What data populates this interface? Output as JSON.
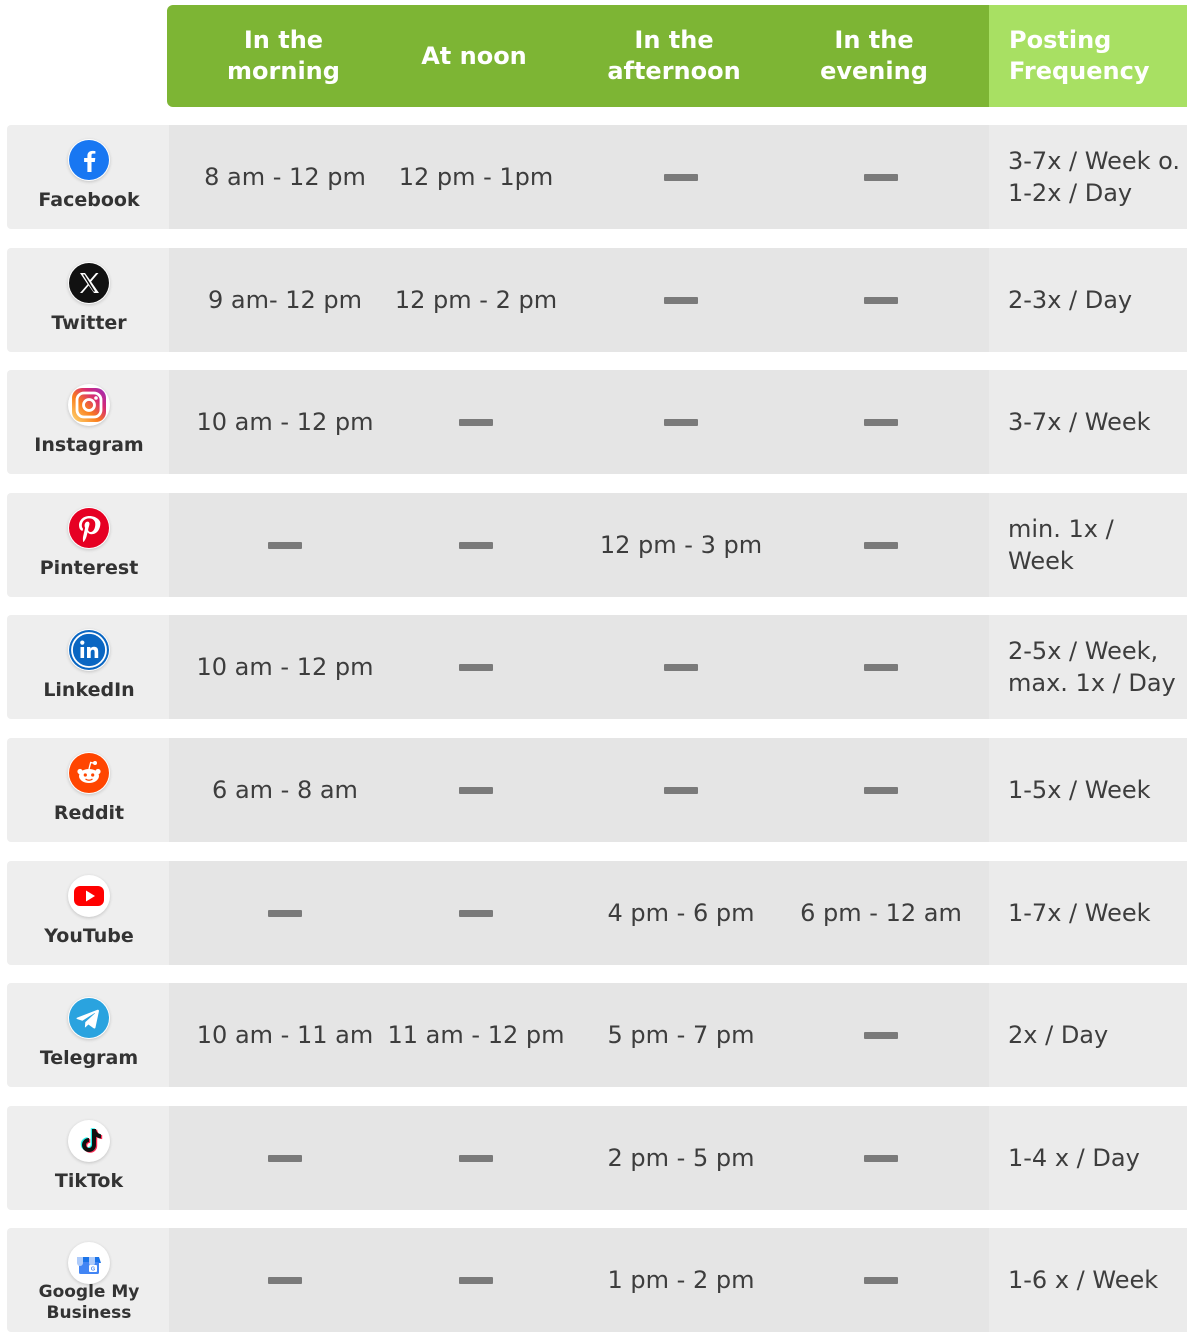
{
  "header": {
    "col_morning": "In the\nmorning",
    "col_noon": "At noon",
    "col_afternoon": "In the\nafternoon",
    "col_evening": "In the\nevening",
    "col_frequency": "Posting\nFrequency"
  },
  "colors": {
    "header_green": "#7db534",
    "frequency_header_green": "#a8e063",
    "facebook_blue": "#1877f2",
    "instagram_gradient": "#e1306c",
    "pinterest_red": "#e60023",
    "linkedin_blue": "#0a66c2",
    "reddit_orange": "#ff4500",
    "youtube_red": "#ff0000",
    "telegram_blue": "#2aa3df",
    "gmb_blue": "#4285f4"
  },
  "rows": [
    {
      "platform": "Facebook",
      "icon": "facebook-icon",
      "morning": "8 am - 12 pm",
      "noon": "12 pm - 1pm",
      "afternoon": null,
      "evening": null,
      "frequency": "3-7x / Week o.\n1-2x / Day"
    },
    {
      "platform": "Twitter",
      "icon": "x-icon",
      "morning": "9 am- 12 pm",
      "noon": "12 pm - 2 pm",
      "afternoon": null,
      "evening": null,
      "frequency": "2-3x / Day"
    },
    {
      "platform": "Instagram",
      "icon": "instagram-icon",
      "morning": "10 am - 12 pm",
      "noon": null,
      "afternoon": null,
      "evening": null,
      "frequency": "3-7x / Week"
    },
    {
      "platform": "Pinterest",
      "icon": "pinterest-icon",
      "morning": null,
      "noon": null,
      "afternoon": "12 pm - 3 pm",
      "evening": null,
      "frequency": "min. 1x /\nWeek"
    },
    {
      "platform": "LinkedIn",
      "icon": "linkedin-icon",
      "morning": "10 am - 12 pm",
      "noon": null,
      "afternoon": null,
      "evening": null,
      "frequency": "2-5x / Week,\nmax. 1x / Day"
    },
    {
      "platform": "Reddit",
      "icon": "reddit-icon",
      "morning": "6 am - 8 am",
      "noon": null,
      "afternoon": null,
      "evening": null,
      "frequency": "1-5x / Week"
    },
    {
      "platform": "YouTube",
      "icon": "youtube-icon",
      "morning": null,
      "noon": null,
      "afternoon": "4 pm - 6 pm",
      "evening": "6 pm - 12 am",
      "frequency": "1-7x / Week"
    },
    {
      "platform": "Telegram",
      "icon": "telegram-icon",
      "morning": "10 am - 11 am",
      "noon": "11 am - 12 pm",
      "afternoon": "5 pm - 7 pm",
      "evening": null,
      "frequency": "2x / Day"
    },
    {
      "platform": "TikTok",
      "icon": "tiktok-icon",
      "morning": null,
      "noon": null,
      "afternoon": "2 pm - 5 pm",
      "evening": null,
      "frequency": "1-4 x / Day"
    },
    {
      "platform": "Google My\nBusiness",
      "icon": "google-my-business-icon",
      "morning": null,
      "noon": null,
      "afternoon": "1 pm - 2 pm",
      "evening": null,
      "frequency": "1-6 x / Week"
    }
  ]
}
